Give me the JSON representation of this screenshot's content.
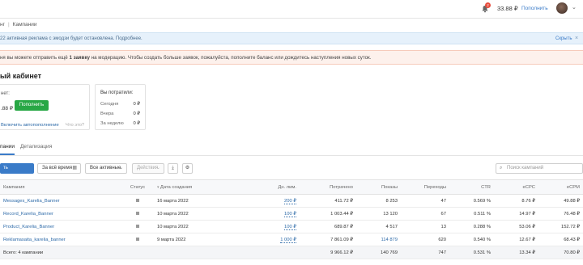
{
  "header": {
    "nav_fragment": "нг",
    "breadcrumb": "Кампании",
    "notification_count": "2",
    "balance": "33.88 ₽",
    "topup_link": "Пополнить"
  },
  "info_banner": {
    "text": "22 активная реклама с эмодзи будет остановлена. Подробнее.",
    "hide_link": "Скрыть"
  },
  "warning_banner": {
    "text_before": "ня вы можете отправить ещё ",
    "text_bold": "1 заявку",
    "text_after": " на модерацию. Чтобы создать больше заявок, пожалуйста, пополните баланс или дождитесь наступления новых суток."
  },
  "cabinet": {
    "title": "ый кабинет",
    "balance_label": "нет:",
    "balance_value": ".88 ₽",
    "topup_button": "Пополнить",
    "autotopup_link": "Включить автопополнение",
    "what_is_it": "Что это?"
  },
  "spent": {
    "title": "Вы потратили:",
    "rows": [
      {
        "label": "Сегодня",
        "value": "0 ₽"
      },
      {
        "label": "Вчера",
        "value": "0 ₽"
      },
      {
        "label": "За неделю",
        "value": "0 ₽"
      }
    ]
  },
  "tabs": {
    "campaigns": "пании",
    "details": "Детализация"
  },
  "toolbar": {
    "create_button": "ть объявление",
    "period": "За всё время",
    "status_filter": "Все активные",
    "actions": "Действия",
    "search_placeholder": "Поиск кампаний"
  },
  "table": {
    "columns": {
      "campaign": "Кампания",
      "status": "Статус",
      "created": "Дата создания",
      "daily_limit": "Дн. лим.",
      "spent": "Потрачено",
      "impressions": "Показы",
      "clicks": "Переходы",
      "ctr": "CTR",
      "ecpc": "eCPC",
      "ecpm": "eCPM"
    },
    "rows": [
      {
        "name": "Messages_Karelia_Banner",
        "created": "16 марта 2022",
        "limit": "200 ₽",
        "spent": "411.72 ₽",
        "impressions": "8 253",
        "clicks": "47",
        "ctr": "0.569 %",
        "ecpc": "8.76 ₽",
        "ecpm": "49.88 ₽"
      },
      {
        "name": "Record_Karelia_Banner",
        "created": "10 марта 2022",
        "limit": "100 ₽",
        "spent": "1 003.44 ₽",
        "impressions": "13 120",
        "clicks": "67",
        "ctr": "0.511 %",
        "ecpc": "14.97 ₽",
        "ecpm": "76.48 ₽"
      },
      {
        "name": "Product_Karelia_Banner",
        "created": "10 марта 2022",
        "limit": "100 ₽",
        "spent": "689.87 ₽",
        "impressions": "4 517",
        "clicks": "13",
        "ctr": "0.288 %",
        "ecpc": "53.06 ₽",
        "ecpm": "152.72 ₽"
      },
      {
        "name": "Reklamasaita_karelia_banner",
        "created": "9 марта 2022",
        "limit": "1 000 ₽",
        "spent": "7 861.09 ₽",
        "impressions": "114 879",
        "clicks": "620",
        "ctr": "0.540 %",
        "ecpc": "12.67 ₽",
        "ecpm": "68.43 ₽"
      }
    ],
    "total": {
      "label": "Всего: 4 кампании",
      "spent": "9 966.12 ₽",
      "impressions": "140 769",
      "clicks": "747",
      "ctr": "0.531 %",
      "ecpc": "13.34 ₽",
      "ecpm": "70.80 ₽"
    }
  },
  "colors": {
    "accent_blue": "#3a7bc8",
    "green": "#28a745",
    "badge_red": "#e74c3c"
  }
}
